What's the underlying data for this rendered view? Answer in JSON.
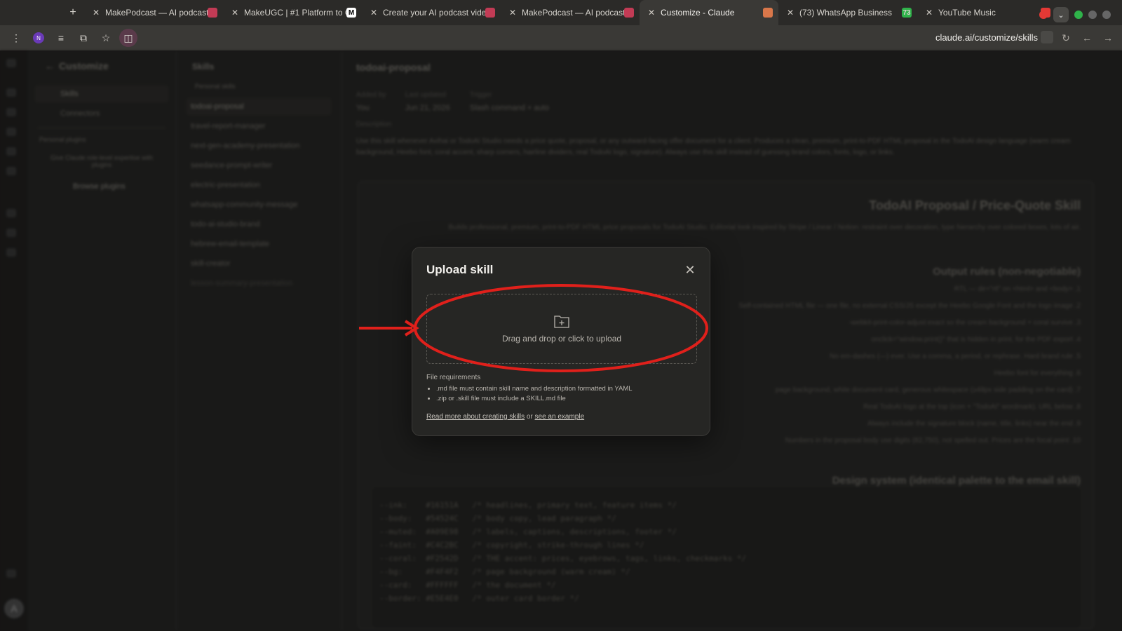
{
  "browser": {
    "tabs": [
      {
        "title": "MakePodcast — AI podcast v",
        "fav_color": "#c23b55",
        "active": false
      },
      {
        "title": "MakeUGC | #1 Platform to Cr",
        "fav_color": "#ffffff",
        "fav_text": "M",
        "active": false
      },
      {
        "title": "Create your AI podcast video",
        "fav_color": "#c23b55",
        "active": false
      },
      {
        "title": "MakePodcast — AI podcast v",
        "fav_color": "#c23b55",
        "active": false
      },
      {
        "title": "Customize - Claude",
        "fav_color": "#d9774a",
        "active": true
      },
      {
        "title": "(73) WhatsApp Business",
        "fav_color": "#2fb34a",
        "fav_text": "73",
        "active": false
      },
      {
        "title": "YouTube Music",
        "fav_color": "#e53935",
        "active": false
      }
    ],
    "url": "claude.ai/customize/skills",
    "profile_initial": "N"
  },
  "sidebar": {
    "title": "Customize",
    "items": [
      {
        "label": "Skills"
      },
      {
        "label": "Connectors"
      }
    ],
    "section": "Personal plugins",
    "empty_text": "Give Claude role-level expertise with plugins",
    "browse": "Browse plugins",
    "user_initial": "A"
  },
  "skills_panel": {
    "title": "Skills",
    "group": "Personal skills",
    "items": [
      "todoai-proposal",
      "travel-report-manager",
      "next-gen-academy-presentation",
      "seedance-prompt-writer",
      "electric-presentation",
      "whatsapp-community-message",
      "todo-ai-studio-brand",
      "hebrew-email-template",
      "skill-creator",
      "lesson-summary-presentation"
    ]
  },
  "detail": {
    "title": "todoai-proposal",
    "meta": [
      {
        "label": "Added by",
        "value": "You"
      },
      {
        "label": "Last updated",
        "value": "Jun 21, 2026"
      },
      {
        "label": "Trigger",
        "value": "Slash command + auto"
      }
    ],
    "desc_label": "Description",
    "description": "Use this skill whenever Avihai or TodoAI Studio needs a price quote, proposal, or any outward-facing offer document for a client. Produces a clean, premium, print-to-PDF HTML proposal in the TodoAI design language (warm cream background, Heebo font, coral accent, sharp corners, hairline dividers, real TodoAI logo, signature). Always use this skill instead of guessing brand colors, fonts, logo, or links.",
    "doc_title": "TodoAI Proposal / Price-Quote Skill",
    "doc_intro": "Builds professional, premium, print-to-PDF HTML price proposals for TodoAI Studio. Editorial look inspired by Stripe / Linear / Notion: restraint over decoration, type hierarchy over colored boxes, lots of air.",
    "doc_h2_rules": "Output rules (non-negotiable)",
    "doc_rules": [
      "RTL — dir=\"rtl\" on <html> and <body> .1",
      "Self-contained HTML file — one file, no external CSS/JS except the Heebo Google Font and the logo image .2",
      "-webkit-print-color-adjust:exact so the cream background + coral survive .3",
      "onclick=\"window.print()\" that is hidden in print, for the PDF export .4",
      "No em-dashes (—) ever. Use a comma, a period, or rephrase. Hard brand rule .5",
      "Heebo font for everything .6",
      "page background, white document card, generous whitespace (≥48px side padding on the card) .7",
      "Real TodoAI logo at the top (icon + \"TodoAI\" wordmark). URL below .8",
      "Always include the signature block (name, title, links) near the end .9",
      "Numbers in the proposal body use digits (82,750), not spelled out. Prices are the focal point .10"
    ],
    "doc_h2_design": "Design system (identical palette to the email skill)",
    "code_lines": [
      "--ink:    #16151A   /* headlines, primary text, feature items */",
      "--body:   #54524C   /* body copy, lead paragraph */",
      "--muted:  #A09E98   /* labels, captions, descriptions, footer */",
      "--faint:  #C4C2BC   /* copyright, strike-through lines */",
      "--coral:  #F2542D   /* THE accent: prices, eyebrows, tags, links, checkmarks */",
      "--bg:     #F4F4F2   /* page background (warm cream) */",
      "--card:   #FFFFFF   /* the document */",
      "--border: #E5E4E0   /* outer card border */"
    ]
  },
  "modal": {
    "title": "Upload skill",
    "drop_text": "Drag and drop or click to upload",
    "req_title": "File requirements",
    "requirements": [
      ".md file must contain skill name and description formatted in YAML",
      ".zip or .skill file must include a SKILL.md file"
    ],
    "link1": "Read more about creating skills",
    "link_sep": " or ",
    "link2": "see an example"
  },
  "annotation": {
    "color": "#e0201b"
  }
}
